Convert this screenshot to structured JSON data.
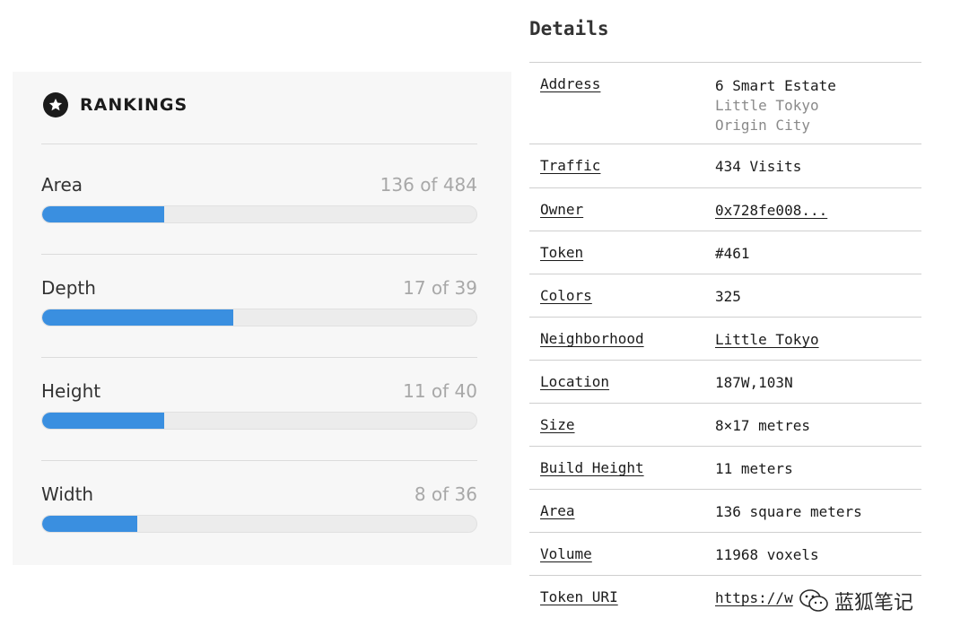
{
  "rankings": {
    "title": "RANKINGS",
    "items": [
      {
        "label": "Area",
        "value_text": "136 of 484",
        "rank": 136,
        "total": 484,
        "fill_fraction": 0.28
      },
      {
        "label": "Depth",
        "value_text": "17 of 39",
        "rank": 17,
        "total": 39,
        "fill_fraction": 0.44
      },
      {
        "label": "Height",
        "value_text": "11 of 40",
        "rank": 11,
        "total": 40,
        "fill_fraction": 0.28
      },
      {
        "label": "Width",
        "value_text": "8 of 36",
        "rank": 8,
        "total": 36,
        "fill_fraction": 0.22
      }
    ],
    "bar_color": "#3a8fe0"
  },
  "details": {
    "title": "Details",
    "address": {
      "key": "Address",
      "line1": "6 Smart Estate",
      "line2": "Little Tokyo",
      "line3": "Origin City"
    },
    "rows": [
      {
        "key": "Traffic",
        "value": "434 Visits",
        "link": false
      },
      {
        "key": "Owner",
        "value": "0x728fe008...",
        "link": true
      },
      {
        "key": "Token",
        "value": "#461",
        "link": false
      },
      {
        "key": "Colors",
        "value": "325",
        "link": false
      },
      {
        "key": "Neighborhood",
        "value": "Little Tokyo",
        "link": true
      },
      {
        "key": "Location",
        "value": "187W,103N",
        "link": false
      },
      {
        "key": "Size",
        "value": "8×17 metres",
        "link": false
      },
      {
        "key": "Build Height",
        "value": "11 meters",
        "link": false
      },
      {
        "key": "Area",
        "value": "136 square meters",
        "link": false
      },
      {
        "key": "Volume",
        "value": "11968 voxels",
        "link": false
      },
      {
        "key": "Token URI",
        "value": "https://w",
        "link": true
      }
    ]
  },
  "watermark": {
    "text": "蓝狐笔记"
  }
}
